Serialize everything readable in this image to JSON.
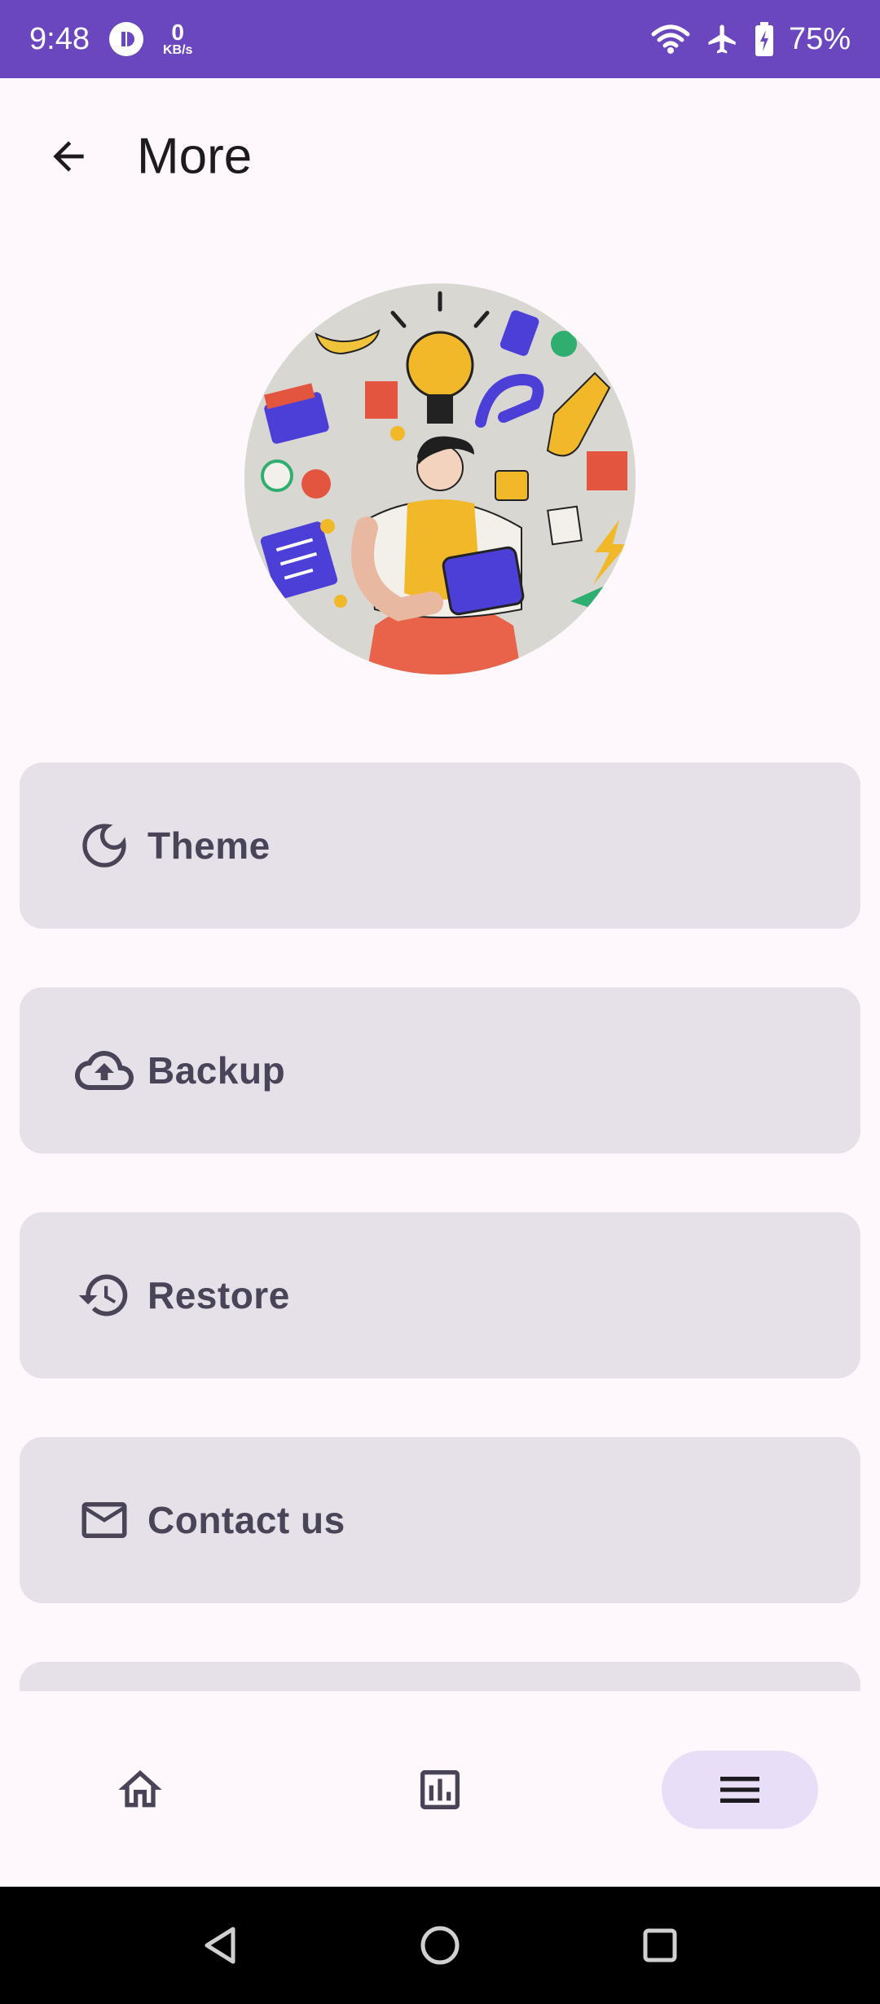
{
  "status_bar": {
    "time": "9:48",
    "net_speed_value": "0",
    "net_speed_unit": "KB/s",
    "battery": "75%",
    "icons": [
      "app-notification-icon",
      "wifi-icon",
      "airplane-mode-icon",
      "battery-charging-icon"
    ]
  },
  "top_bar": {
    "title": "More",
    "back_icon": "arrow-back-icon"
  },
  "menu": {
    "items": [
      {
        "label": "Theme",
        "icon": "moon-icon"
      },
      {
        "label": "Backup",
        "icon": "cloud-upload-icon"
      },
      {
        "label": "Restore",
        "icon": "history-icon"
      },
      {
        "label": "Contact us",
        "icon": "mail-icon"
      }
    ]
  },
  "bottom_nav": {
    "items": [
      {
        "icon": "home-icon",
        "selected": false
      },
      {
        "icon": "bar-chart-icon",
        "selected": false
      },
      {
        "icon": "menu-icon",
        "selected": true
      }
    ]
  },
  "system_nav": {
    "icons": [
      "back-triangle-icon",
      "home-circle-icon",
      "recents-square-icon"
    ]
  },
  "colors": {
    "status_bar": "#6B47BF",
    "background": "#FEF8FC",
    "card": "#E6E0E9",
    "card_text": "#4A4458",
    "nav_selected": "#E8DEF8"
  }
}
